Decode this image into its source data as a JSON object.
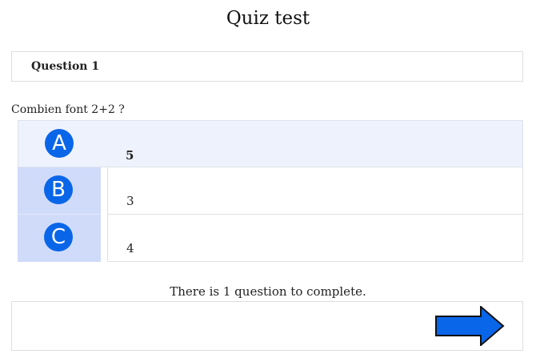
{
  "page": {
    "title": "Quiz test"
  },
  "question": {
    "header_label": "Question 1",
    "text": "Combien font 2+2 ?",
    "answers": [
      {
        "letter": "A",
        "value": "5",
        "selected": true
      },
      {
        "letter": "B",
        "value": "3",
        "selected": false
      },
      {
        "letter": "C",
        "value": "4",
        "selected": false
      }
    ]
  },
  "status": {
    "text": "There is 1 question to complete."
  },
  "footer": {
    "next_icon": "right-arrow-icon"
  },
  "colors": {
    "badge": "#0a66e8",
    "selected_row": "#eef2fc",
    "letter_cell": "#d0dbfa",
    "arrow_fill": "#0a66e8"
  }
}
